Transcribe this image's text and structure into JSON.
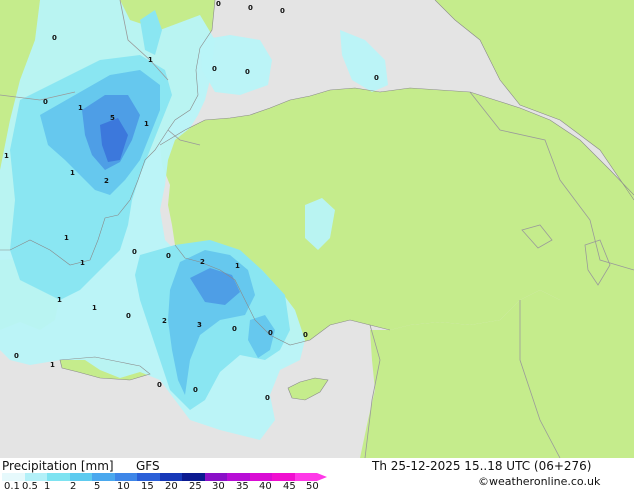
{
  "header": {
    "product": "Precipitation [mm]",
    "model": "GFS",
    "valid_time": "Th 25-12-2025 15..18 UTC (06+276)",
    "credit": "©weatheronline.co.uk"
  },
  "legend": {
    "ticks": [
      "0.1",
      "0.5",
      "1",
      "2",
      "5",
      "10",
      "15",
      "20",
      "25",
      "30",
      "35",
      "40",
      "45",
      "50"
    ],
    "colors": [
      "#e6f9fc",
      "#b3f0f8",
      "#7ee3f1",
      "#5ecbef",
      "#4aa8ee",
      "#3e86e8",
      "#2a5fd8",
      "#1638b8",
      "#0b1a90",
      "#8a10c8",
      "#b70ed6",
      "#d90cd4",
      "#f00fd0",
      "#ff38e8"
    ]
  },
  "map": {
    "colors": {
      "sea": "#e4e4e4",
      "land": "#c5ec8c",
      "p01": "#b8f4f8",
      "p05": "#8ae6f2",
      "p1": "#66c8ee",
      "p2": "#4e9ee6",
      "p5": "#3c78dc",
      "border": "#9a9a9a"
    },
    "contour_labels": [
      "0",
      "0",
      "0",
      "0",
      "1",
      "0",
      "0",
      "0",
      "1",
      "5",
      "1",
      "0",
      "1",
      "2",
      "1",
      "1",
      "0",
      "0",
      "2",
      "1",
      "1",
      "1",
      "0",
      "2",
      "3",
      "0",
      "0",
      "0",
      "0",
      "1",
      "0",
      "0",
      "1",
      "0"
    ]
  }
}
